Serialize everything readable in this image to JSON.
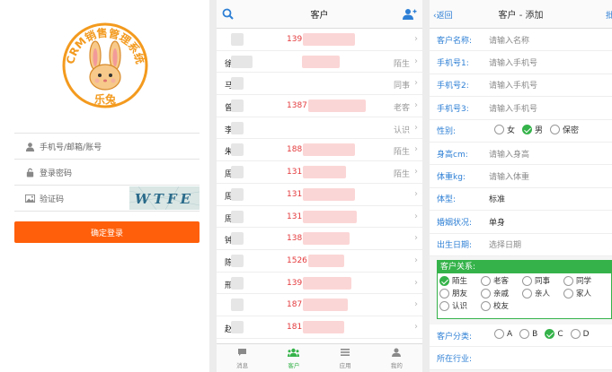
{
  "login": {
    "logo_arc_text": "CRM销售管理系统",
    "logo_name": "乐兔",
    "phone_placeholder": "手机号/邮箱/账号",
    "password_placeholder": "登录密码",
    "captcha_placeholder": "验证码",
    "captcha_text": "WTFE",
    "submit_label": "确定登录",
    "accent_color": "#ff5f0a"
  },
  "list": {
    "title": "客户",
    "left_icon": "search-icon",
    "right_icon": "add-user-icon",
    "rows": [
      {
        "name": "",
        "phone": "139",
        "tag": ""
      },
      {
        "name": "徐辉",
        "phone": "",
        "tag": "陌生"
      },
      {
        "name": "马",
        "phone": "",
        "tag": "同事"
      },
      {
        "name": "曾",
        "phone": "1387",
        "tag": "老客"
      },
      {
        "name": "李",
        "phone": "",
        "tag": "认识"
      },
      {
        "name": "朱",
        "phone": "188",
        "tag": "陌生"
      },
      {
        "name": "周",
        "phone": "131",
        "tag": "陌生"
      },
      {
        "name": "周",
        "phone": "131",
        "tag": ""
      },
      {
        "name": "周",
        "phone": "131",
        "tag": ""
      },
      {
        "name": "钟",
        "phone": "138",
        "tag": ""
      },
      {
        "name": "陈",
        "phone": "1526",
        "tag": ""
      },
      {
        "name": "邢",
        "phone": "139",
        "tag": ""
      },
      {
        "name": "",
        "phone": "187",
        "tag": ""
      },
      {
        "name": "赵",
        "phone": "181",
        "tag": ""
      }
    ],
    "tabs": [
      {
        "label": "消息",
        "icon": "chat-icon",
        "active": false
      },
      {
        "label": "客户",
        "icon": "customers-icon",
        "active": true
      },
      {
        "label": "应用",
        "icon": "apps-icon",
        "active": false
      },
      {
        "label": "我的",
        "icon": "profile-icon",
        "active": false
      }
    ],
    "active_color": "#35b34a"
  },
  "add": {
    "back_label": "返回",
    "title": "客户 - 添加",
    "batch_label": "批",
    "fields": [
      {
        "label": "客户名称:",
        "placeholder": "请输入名称"
      },
      {
        "label": "手机号1:",
        "placeholder": "请输入手机号"
      },
      {
        "label": "手机号2:",
        "placeholder": "请输入手机号"
      },
      {
        "label": "手机号3:",
        "placeholder": "请输入手机号"
      }
    ],
    "gender_label": "性别:",
    "gender_options": [
      "女",
      "男",
      "保密"
    ],
    "gender_selected": "男",
    "height_label": "身高cm:",
    "height_placeholder": "请输入身高",
    "weight_label": "体重kg:",
    "weight_placeholder": "请输入体重",
    "body_label": "体型:",
    "body_value": "标准",
    "marital_label": "婚姻状况:",
    "marital_value": "单身",
    "birth_label": "出生日期:",
    "birth_placeholder": "选择日期",
    "relation_label": "客户关系:",
    "relation_options": [
      "陌生",
      "老客",
      "同事",
      "同学",
      "朋友",
      "亲戚",
      "亲人",
      "家人",
      "认识",
      "校友"
    ],
    "relation_selected": "陌生",
    "category_label": "客户分类:",
    "category_options": [
      "A",
      "B",
      "C",
      "D"
    ],
    "category_selected": "C",
    "industry_label": "所在行业:",
    "link_color": "#2d7fd5"
  }
}
